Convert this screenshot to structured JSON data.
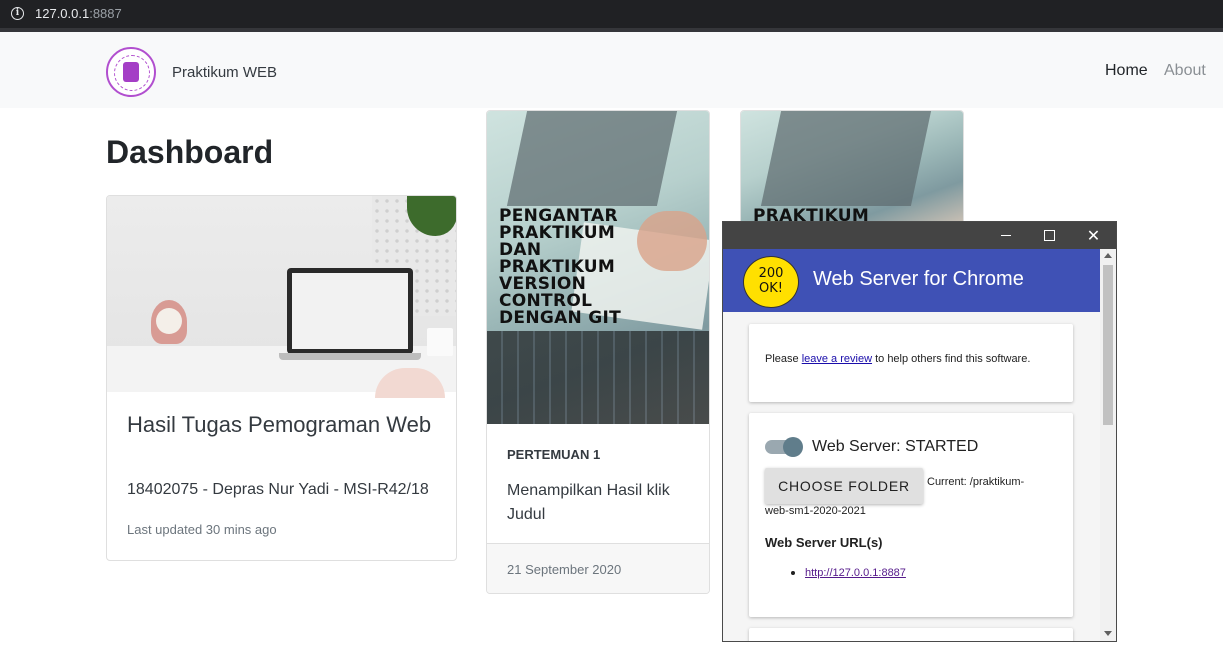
{
  "browser": {
    "url_host": "127.0.0.1",
    "url_port": ":8887",
    "info_icon": "info-icon"
  },
  "navbar": {
    "brand": "Praktikum WEB",
    "links": [
      {
        "label": "Home",
        "active": true
      },
      {
        "label": "About",
        "active": false
      }
    ]
  },
  "page": {
    "title": "Dashboard"
  },
  "cards": [
    {
      "title": "Hasil Tugas Pemograman Web",
      "subtitle": "18402075 - Depras Nur Yadi - MSI-R42/18",
      "updated": "Last updated 30 mins ago"
    },
    {
      "image_text_lines": [
        "PENGANTAR",
        "PRAKTIKUM",
        "DAN",
        "PRAKTIKUM",
        "VERSION",
        "CONTROL",
        "DENGAN GIT"
      ],
      "kicker": "PERTEMUAN 1",
      "description": "Menampilkan Hasil klik Judul",
      "date": "21 September 2020"
    },
    {
      "image_text_lines": [
        "PRAKTIKUM"
      ]
    }
  ],
  "webserver": {
    "badge_line1": "200",
    "badge_line2": "OK!",
    "title": "Web Server for Chrome",
    "review_prefix": "Please ",
    "review_link": "leave a review",
    "review_suffix": " to help others find this software.",
    "status": "Web Server: STARTED",
    "toggle_on": true,
    "choose_folder": "CHOOSE FOLDER",
    "current_line1": "Current: /praktikum-",
    "current_line2": "web-sm1-2020-2021",
    "urls_heading": "Web Server URL(s)",
    "urls": [
      "http://127.0.0.1:8887"
    ],
    "accent_color": "#3f51b5"
  }
}
